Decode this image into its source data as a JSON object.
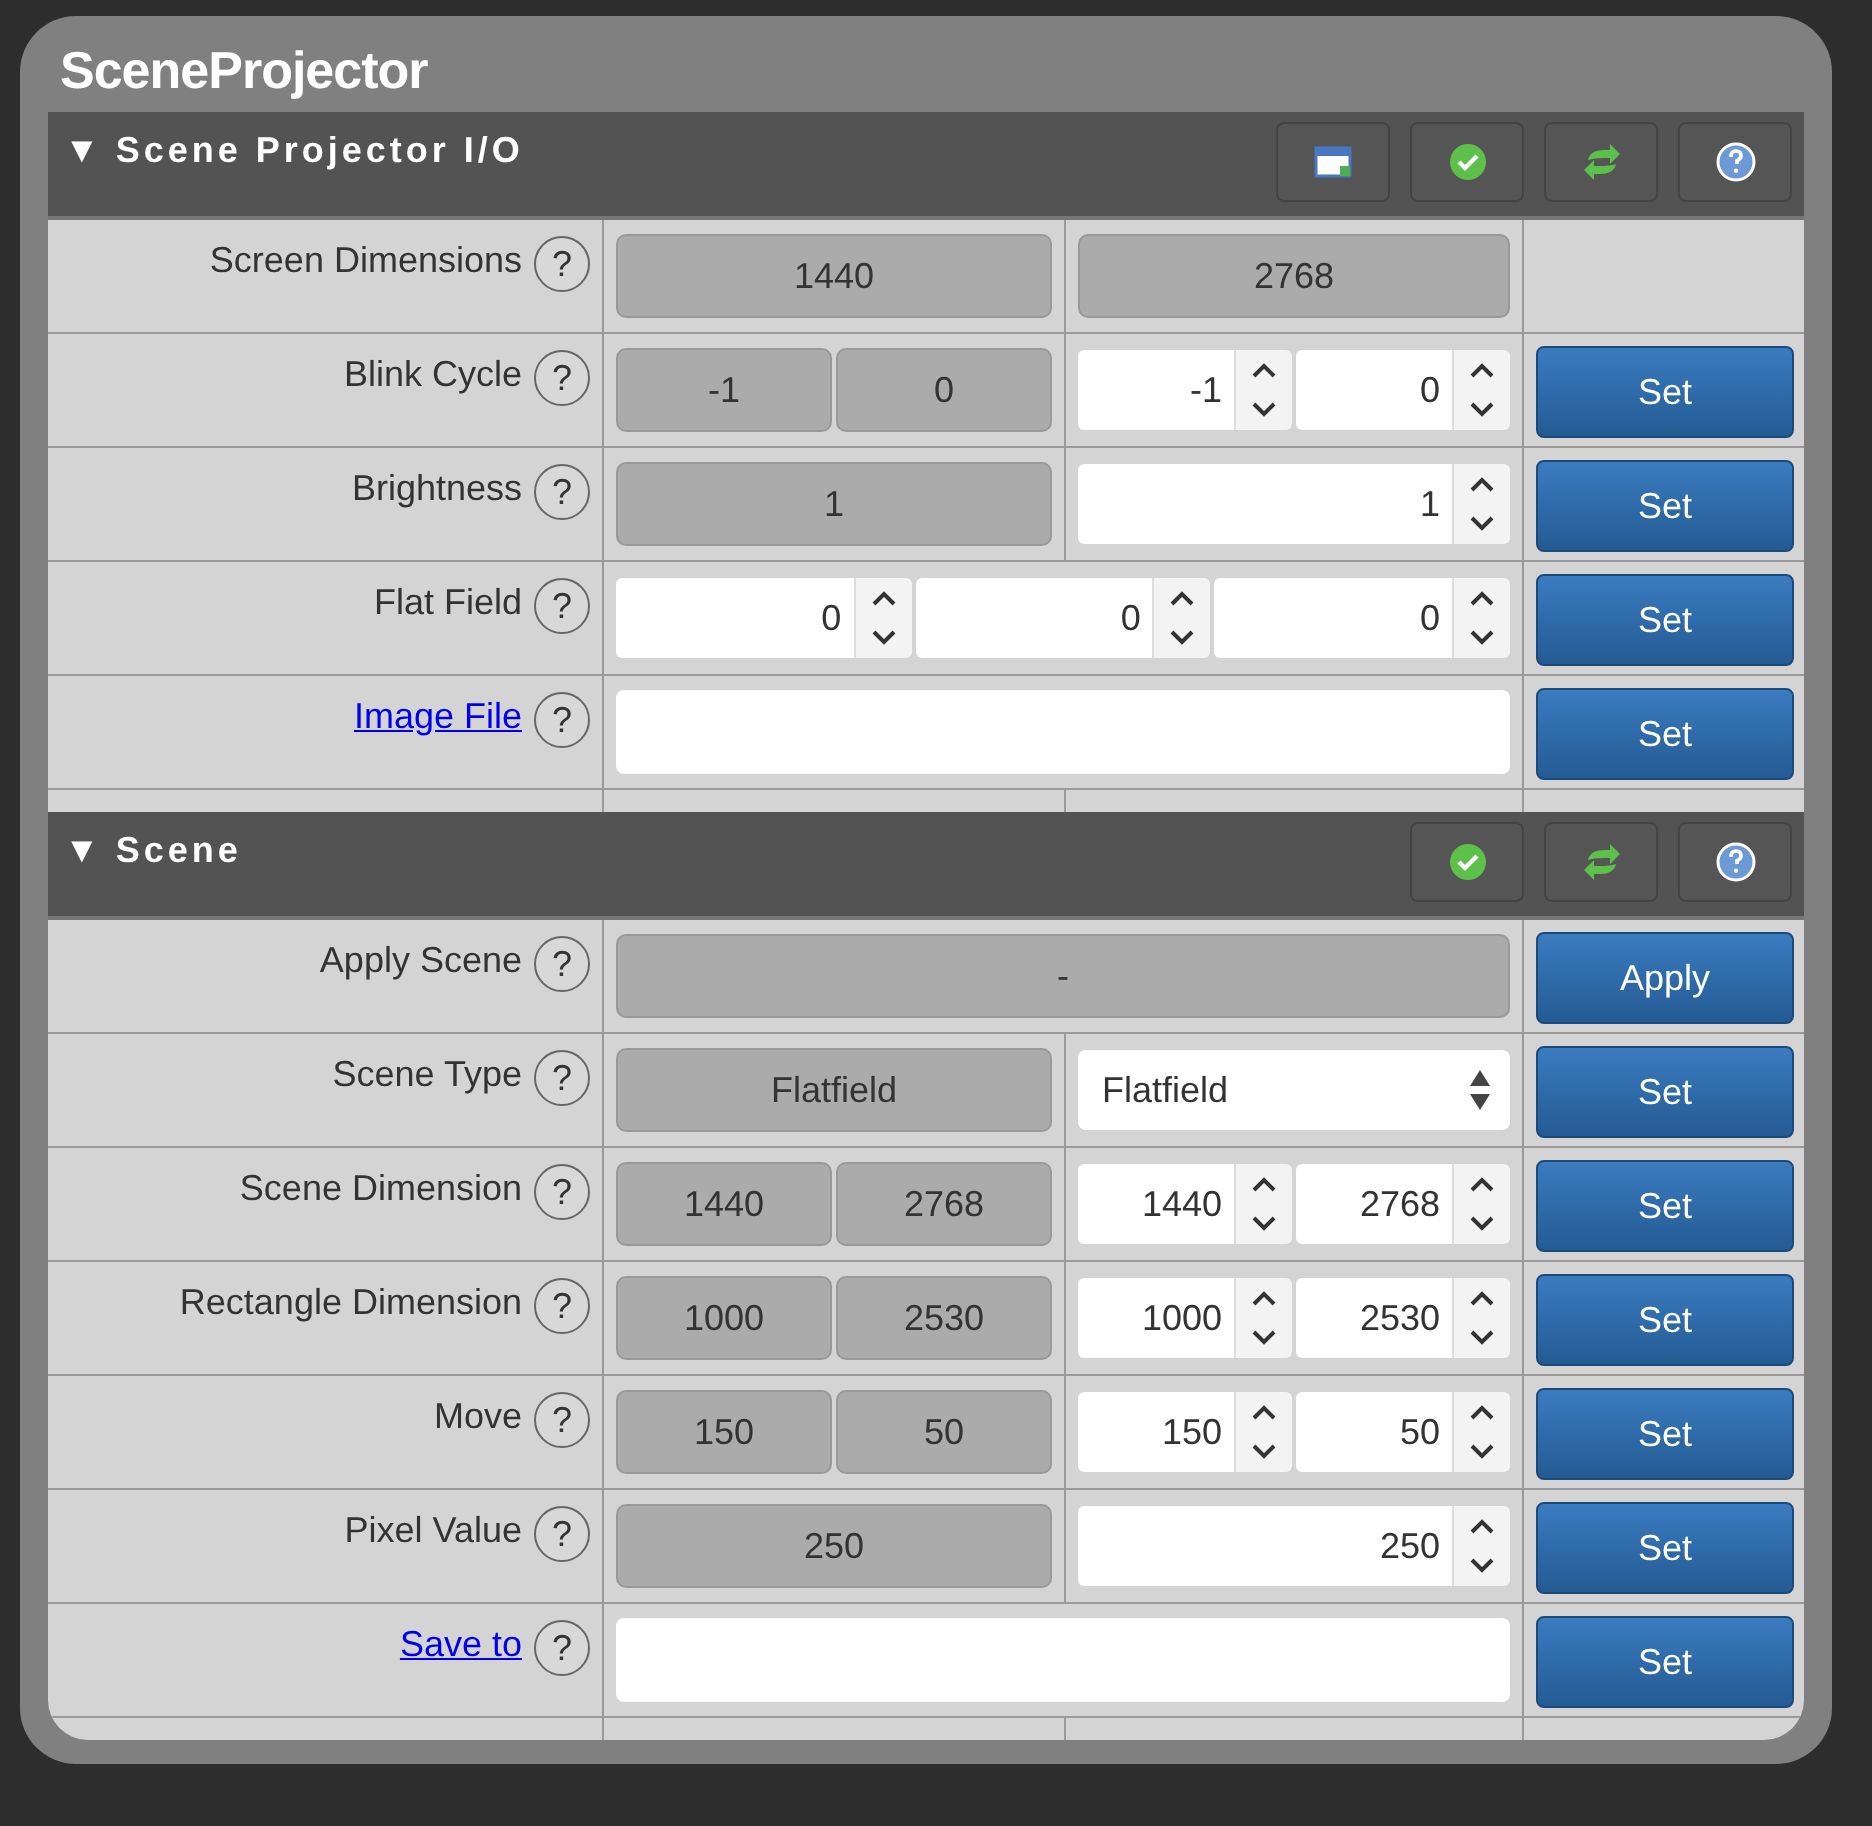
{
  "window": {
    "title": "SceneProjector"
  },
  "sections": [
    {
      "toggle": "▼",
      "title": "Scene Projector I/O",
      "tools": [
        {
          "kind": "window"
        },
        {
          "kind": "check"
        },
        {
          "kind": "refresh"
        },
        {
          "kind": "help"
        }
      ],
      "rows": [
        {
          "label": "Screen Dimensions",
          "link": false,
          "help": "?",
          "cells": [
            {
              "kind": "readouts",
              "wide": false,
              "values": [
                "1440"
              ]
            },
            {
              "kind": "readouts",
              "wide": false,
              "values": [
                "2768"
              ]
            }
          ]
        },
        {
          "label": "Blink Cycle",
          "link": false,
          "help": "?",
          "cells": [
            {
              "kind": "readouts",
              "wide": false,
              "values": [
                "-1",
                "0"
              ]
            },
            {
              "kind": "spinners",
              "wide": false,
              "values": [
                "-1",
                "0"
              ]
            }
          ],
          "action": "Set"
        },
        {
          "label": "Brightness",
          "link": false,
          "help": "?",
          "cells": [
            {
              "kind": "readouts",
              "wide": false,
              "values": [
                "1"
              ]
            },
            {
              "kind": "spinners",
              "wide": false,
              "values": [
                "1"
              ]
            }
          ],
          "action": "Set"
        },
        {
          "label": "Flat Field",
          "link": false,
          "help": "?",
          "cells": [
            {
              "kind": "spinners",
              "wide": true,
              "values": [
                "0",
                "0",
                "0"
              ]
            }
          ],
          "action": "Set"
        },
        {
          "label": "Image File",
          "link": true,
          "help": "?",
          "cells": [
            {
              "kind": "text",
              "wide": true
            }
          ],
          "action": "Set"
        }
      ]
    },
    {
      "toggle": "▼",
      "title": "Scene",
      "tools": [
        {
          "kind": "check"
        },
        {
          "kind": "refresh"
        },
        {
          "kind": "help"
        }
      ],
      "rows": [
        {
          "label": "Apply Scene",
          "link": false,
          "help": "?",
          "cells": [
            {
              "kind": "readouts",
              "wide": true,
              "values": [
                "-"
              ]
            }
          ],
          "action": "Apply"
        },
        {
          "label": "Scene Type",
          "link": false,
          "help": "?",
          "cells": [
            {
              "kind": "readouts",
              "wide": false,
              "values": [
                "Flatfield"
              ]
            },
            {
              "kind": "select",
              "wide": false,
              "values": [
                "Flatfield"
              ]
            }
          ],
          "action": "Set"
        },
        {
          "label": "Scene Dimension",
          "link": false,
          "help": "?",
          "cells": [
            {
              "kind": "readouts",
              "wide": false,
              "values": [
                "1440",
                "2768"
              ]
            },
            {
              "kind": "spinners",
              "wide": false,
              "values": [
                "1440",
                "2768"
              ]
            }
          ],
          "action": "Set"
        },
        {
          "label": "Rectangle Dimension",
          "link": false,
          "help": "?",
          "cells": [
            {
              "kind": "readouts",
              "wide": false,
              "values": [
                "1000",
                "2530"
              ]
            },
            {
              "kind": "spinners",
              "wide": false,
              "values": [
                "1000",
                "2530"
              ]
            }
          ],
          "action": "Set"
        },
        {
          "label": "Move",
          "link": false,
          "help": "?",
          "cells": [
            {
              "kind": "readouts",
              "wide": false,
              "values": [
                "150",
                "50"
              ]
            },
            {
              "kind": "spinners",
              "wide": false,
              "values": [
                "150",
                "50"
              ]
            }
          ],
          "action": "Set"
        },
        {
          "label": "Pixel Value",
          "link": false,
          "help": "?",
          "cells": [
            {
              "kind": "readouts",
              "wide": false,
              "values": [
                "250"
              ]
            },
            {
              "kind": "spinners",
              "wide": false,
              "values": [
                "250"
              ]
            }
          ],
          "action": "Set"
        },
        {
          "label": "Save to",
          "link": true,
          "help": "?",
          "cells": [
            {
              "kind": "text",
              "wide": true
            }
          ],
          "action": "Set"
        }
      ]
    }
  ]
}
